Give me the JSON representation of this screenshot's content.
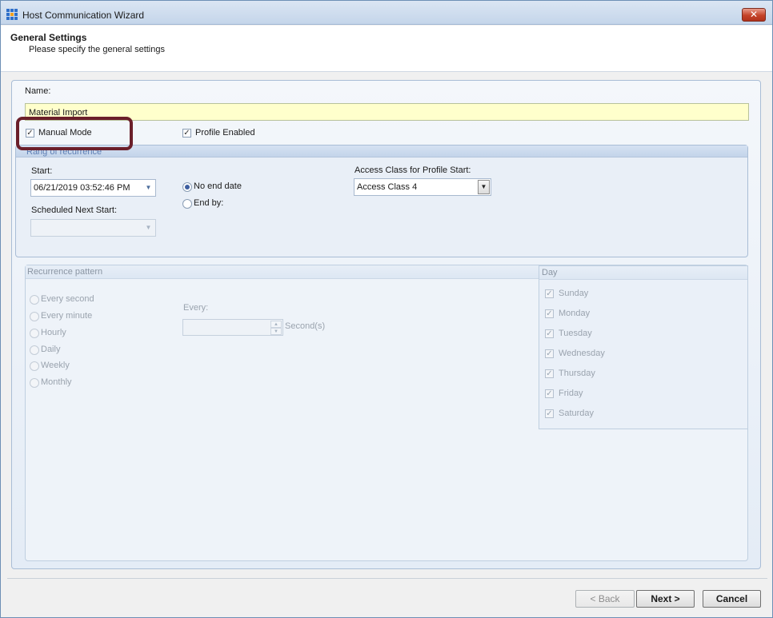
{
  "window": {
    "title": "Host Communication Wizard",
    "close_label": "✕"
  },
  "header": {
    "title": "General Settings",
    "subtitle": "Please specify the general settings"
  },
  "name_section": {
    "label": "Name:",
    "value": "Material Import"
  },
  "options": {
    "manual_mode": {
      "label": "Manual Mode",
      "checked": true,
      "mark": "✓"
    },
    "profile_enabled": {
      "label": "Profile Enabled",
      "checked": true,
      "mark": "✓"
    }
  },
  "range": {
    "title": "Rang of recurrence",
    "start_label": "Start:",
    "start_value": "06/21/2019 03:52:46 PM",
    "scheduled_label": "Scheduled Next Start:",
    "scheduled_value": "",
    "no_end_label": "No end date",
    "end_by_label": "End by:",
    "end_option_selected": "No end date",
    "access_label": "Access Class for Profile Start:",
    "access_value": "Access Class 4"
  },
  "pattern": {
    "title": "Recurrence pattern",
    "options": [
      "Every second",
      "Every minute",
      "Hourly",
      "Daily",
      "Weekly",
      "Monthly"
    ],
    "every_label": "Every:",
    "every_value": "",
    "unit_label": "Second(s)"
  },
  "day": {
    "title": "Day",
    "mark": "✓",
    "days": [
      "Sunday",
      "Monday",
      "Tuesday",
      "Wednesday",
      "Thursday",
      "Friday",
      "Saturday"
    ]
  },
  "footer": {
    "back": "< Back",
    "next": "Next >",
    "cancel": "Cancel"
  },
  "icons": {
    "combo_arrow": "▼",
    "spin_up": "▲",
    "spin_down": "▼"
  },
  "colors": {
    "name_field_bg": "#ffffcc",
    "highlight_border": "#6b1f2a",
    "panel_title": "#5c7db3"
  }
}
